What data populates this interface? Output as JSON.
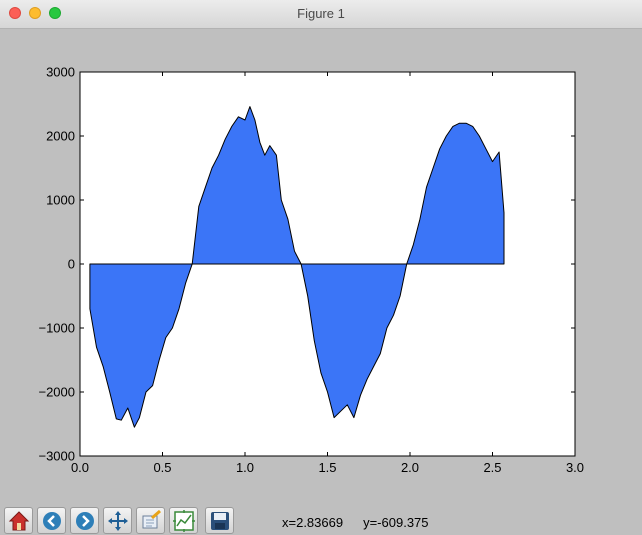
{
  "window": {
    "title": "Figure 1"
  },
  "toolbar": {
    "buttons": [
      {
        "icon": "home-icon"
      },
      {
        "icon": "back-arrow-icon"
      },
      {
        "icon": "forward-arrow-icon"
      },
      {
        "icon": "pan-icon"
      },
      {
        "icon": "zoom-rectangle-icon"
      },
      {
        "icon": "subplots-configure-icon"
      },
      {
        "icon": "save-icon"
      }
    ],
    "x_readout": "x=2.83669",
    "y_readout": "y=-609.375"
  },
  "chart_data": {
    "type": "area",
    "title": "",
    "xlabel": "",
    "ylabel": "",
    "xlim": [
      0.0,
      3.0
    ],
    "ylim": [
      -3000,
      3000
    ],
    "xticks": [
      "0.0",
      "0.5",
      "1.0",
      "1.5",
      "2.0",
      "2.5",
      "3.0"
    ],
    "yticks": [
      "3000",
      "2000",
      "1000",
      "0",
      "−1000",
      "−2000",
      "−3000"
    ],
    "grid": false,
    "fill_color": "#3b75f7",
    "baseline": 0,
    "series": [
      {
        "x": [
          0.06,
          0.1,
          0.14,
          0.18,
          0.22,
          0.25,
          0.29,
          0.33,
          0.36,
          0.4,
          0.44,
          0.48,
          0.52,
          0.56,
          0.6,
          0.64,
          0.68,
          0.72,
          0.76,
          0.8,
          0.84,
          0.88,
          0.92,
          0.96,
          1.0,
          1.03,
          1.06,
          1.09,
          1.12,
          1.15,
          1.19,
          1.22,
          1.26,
          1.3,
          1.34,
          1.38,
          1.42,
          1.46,
          1.5,
          1.54,
          1.58,
          1.62,
          1.66,
          1.7,
          1.74,
          1.78,
          1.82,
          1.86,
          1.9,
          1.94,
          1.98,
          2.02,
          2.06,
          2.1,
          2.14,
          2.18,
          2.22,
          2.26,
          2.3,
          2.34,
          2.38,
          2.42,
          2.46,
          2.5,
          2.54,
          2.57
        ],
        "y": [
          -700,
          -1300,
          -1600,
          -2000,
          -2420,
          -2440,
          -2250,
          -2550,
          -2400,
          -2000,
          -1900,
          -1500,
          -1150,
          -1000,
          -700,
          -300,
          0,
          900,
          1200,
          1500,
          1700,
          1950,
          2150,
          2300,
          2250,
          2460,
          2250,
          1900,
          1700,
          1850,
          1700,
          1000,
          700,
          200,
          0,
          -500,
          -1200,
          -1700,
          -2000,
          -2400,
          -2300,
          -2200,
          -2400,
          -2050,
          -1800,
          -1600,
          -1400,
          -1000,
          -800,
          -500,
          0,
          300,
          700,
          1200,
          1500,
          1800,
          2000,
          2150,
          2200,
          2200,
          2150,
          2000,
          1800,
          1600,
          1750,
          800
        ]
      }
    ]
  }
}
